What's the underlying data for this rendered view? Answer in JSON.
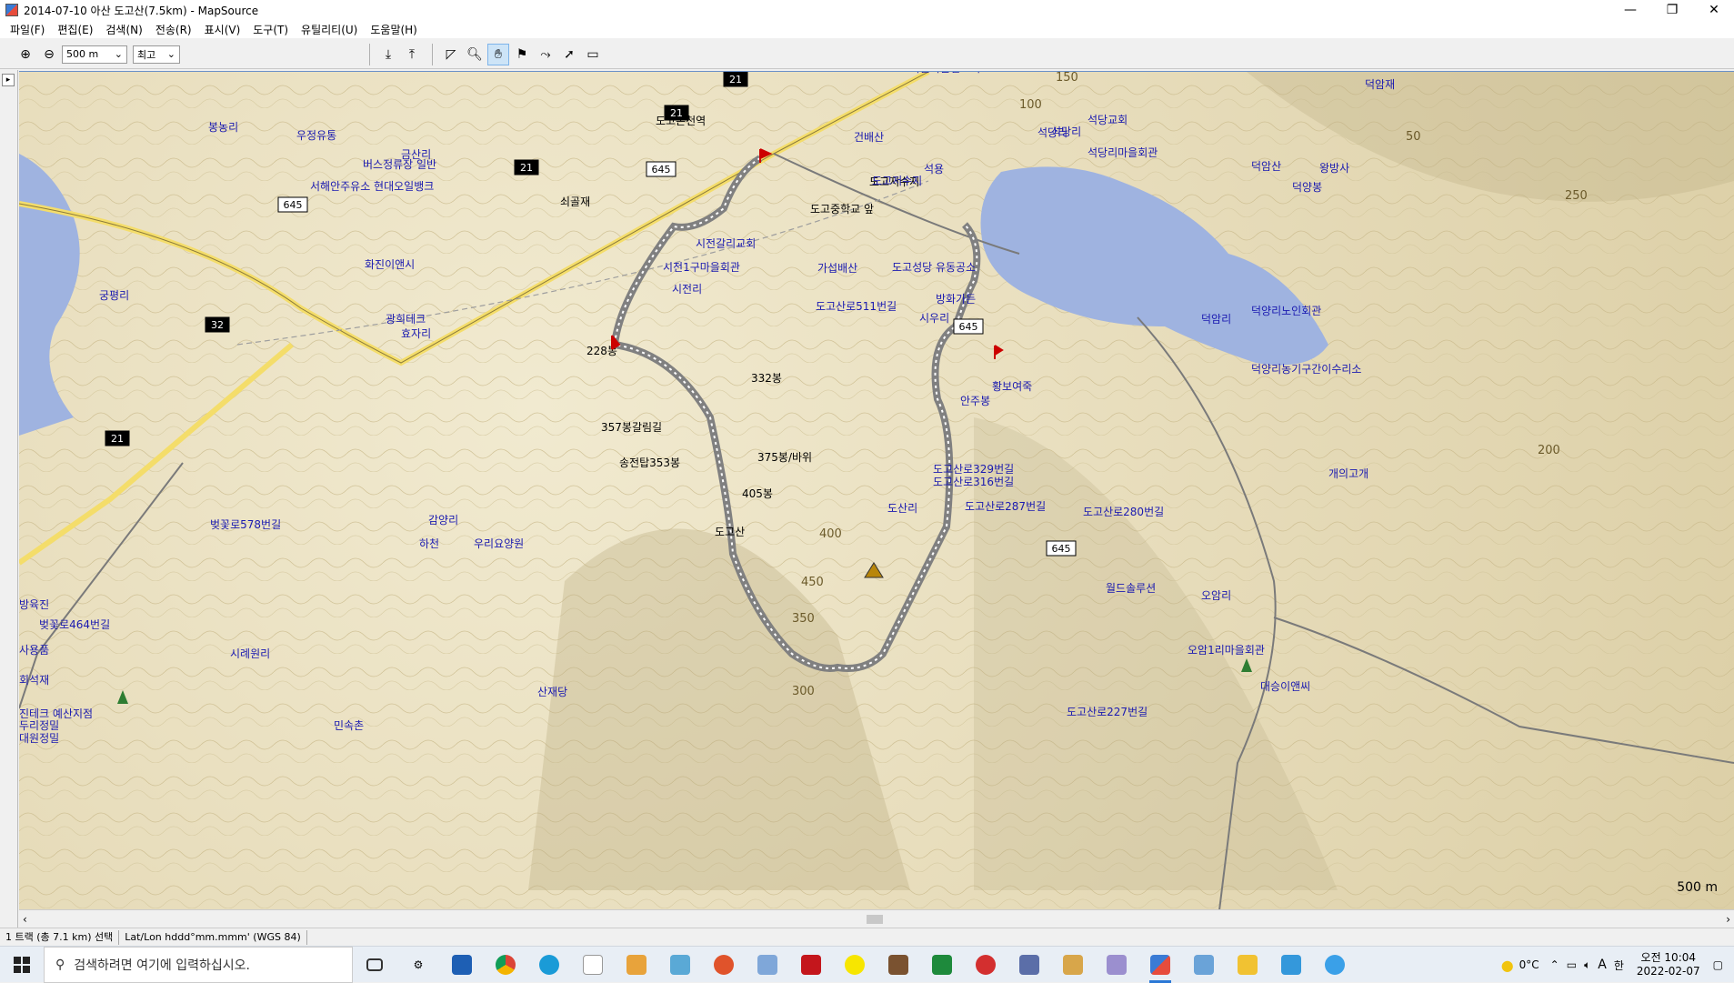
{
  "window": {
    "title": "2014-07-10 아산 도고산(7.5km) - MapSource",
    "minimize": "—",
    "restore": "❐",
    "close": "✕"
  },
  "menu": [
    "파일(F)",
    "편집(E)",
    "검색(N)",
    "전송(R)",
    "표시(V)",
    "도구(T)",
    "유틸리티(U)",
    "도움말(H)"
  ],
  "toolbar": {
    "zoom_value": "500 m",
    "detail_value": "최고"
  },
  "map": {
    "scale_label": "500 m",
    "water_color": "#9fb3e0",
    "track_color": "#808080",
    "labels": [
      {
        "text": "도고온천역"
      },
      {
        "text": "쇠골재"
      },
      {
        "text": "도고중학교 앞"
      },
      {
        "text": "도고저수지"
      },
      {
        "text": "228봉"
      },
      {
        "text": "357봉갈림길"
      },
      {
        "text": "송전탑353봉"
      },
      {
        "text": "332봉"
      },
      {
        "text": "375봉/바위"
      },
      {
        "text": "405봉"
      },
      {
        "text": "도고산"
      },
      {
        "text": "가섭배산"
      },
      {
        "text": "도고산로511번길"
      },
      {
        "text": "시전1구마을회관"
      },
      {
        "text": "시전리"
      },
      {
        "text": "시전갈리교회"
      },
      {
        "text": "도고성당 유동공소"
      },
      {
        "text": "방화가든"
      },
      {
        "text": "시우리"
      },
      {
        "text": "황보여죽"
      },
      {
        "text": "안주봉"
      },
      {
        "text": "도고산로329번길"
      },
      {
        "text": "도고산로316번길"
      },
      {
        "text": "도고산로287번길"
      },
      {
        "text": "도고산로280번길"
      },
      {
        "text": "도산리"
      },
      {
        "text": "석당리"
      },
      {
        "text": "석당교회"
      },
      {
        "text": "석당리마을회관"
      },
      {
        "text": "덕양리노인회관"
      },
      {
        "text": "덕양리농기구간이수리소"
      },
      {
        "text": "덕암산"
      },
      {
        "text": "덕양봉"
      },
      {
        "text": "덕암리"
      },
      {
        "text": "개의고개"
      },
      {
        "text": "월드솔루션"
      },
      {
        "text": "오암리"
      },
      {
        "text": "오암1리마을회관"
      },
      {
        "text": "화진이앤시"
      },
      {
        "text": "광희테크"
      },
      {
        "text": "효자리"
      },
      {
        "text": "금산리"
      },
      {
        "text": "궁평리"
      },
      {
        "text": "봉농리"
      },
      {
        "text": "우정유통"
      },
      {
        "text": "서해안주유소 현대오일뱅크"
      },
      {
        "text": "버스정류장 일반"
      },
      {
        "text": "우리요양원"
      },
      {
        "text": "감양리"
      },
      {
        "text": "산재당"
      },
      {
        "text": "시례원리"
      },
      {
        "text": "민속촌"
      },
      {
        "text": "벚꽃로578번길"
      },
      {
        "text": "벚꽃로464번길"
      },
      {
        "text": "진테크 예산지점"
      },
      {
        "text": "두리정밀"
      },
      {
        "text": "대원정밀"
      },
      {
        "text": "하천"
      },
      {
        "text": "대승이앤씨"
      },
      {
        "text": "도고산로227번길"
      },
      {
        "text": "건배산"
      },
      {
        "text": "도고저수지"
      },
      {
        "text": "석용"
      },
      {
        "text": "석당리"
      },
      {
        "text": "하늘다운선교회"
      },
      {
        "text": "왕방사"
      },
      {
        "text": "덕암재"
      },
      {
        "text": "사용품"
      },
      {
        "text": "회석재"
      },
      {
        "text": "방육진"
      }
    ],
    "roads": [
      {
        "text": "21"
      },
      {
        "text": "21"
      },
      {
        "text": "21"
      },
      {
        "text": "21"
      },
      {
        "text": "645"
      },
      {
        "text": "645"
      },
      {
        "text": "645"
      },
      {
        "text": "645"
      },
      {
        "text": "32"
      }
    ],
    "contours": [
      {
        "text": "150"
      },
      {
        "text": "100"
      },
      {
        "text": "50"
      },
      {
        "text": "250"
      },
      {
        "text": "200"
      },
      {
        "text": "350"
      },
      {
        "text": "400"
      },
      {
        "text": "300"
      },
      {
        "text": "450"
      }
    ]
  },
  "status": {
    "selection": "1 트랙 (총 7.1 km) 선택",
    "coord_format": "Lat/Lon hddd°mm.mmm' (WGS 84)"
  },
  "taskbar": {
    "search_placeholder": "검색하려면 여기에 입력하십시오.",
    "weather": "0°C",
    "ime": "A",
    "lang": "한",
    "time": "오전 10:04",
    "date": "2022-02-07"
  }
}
